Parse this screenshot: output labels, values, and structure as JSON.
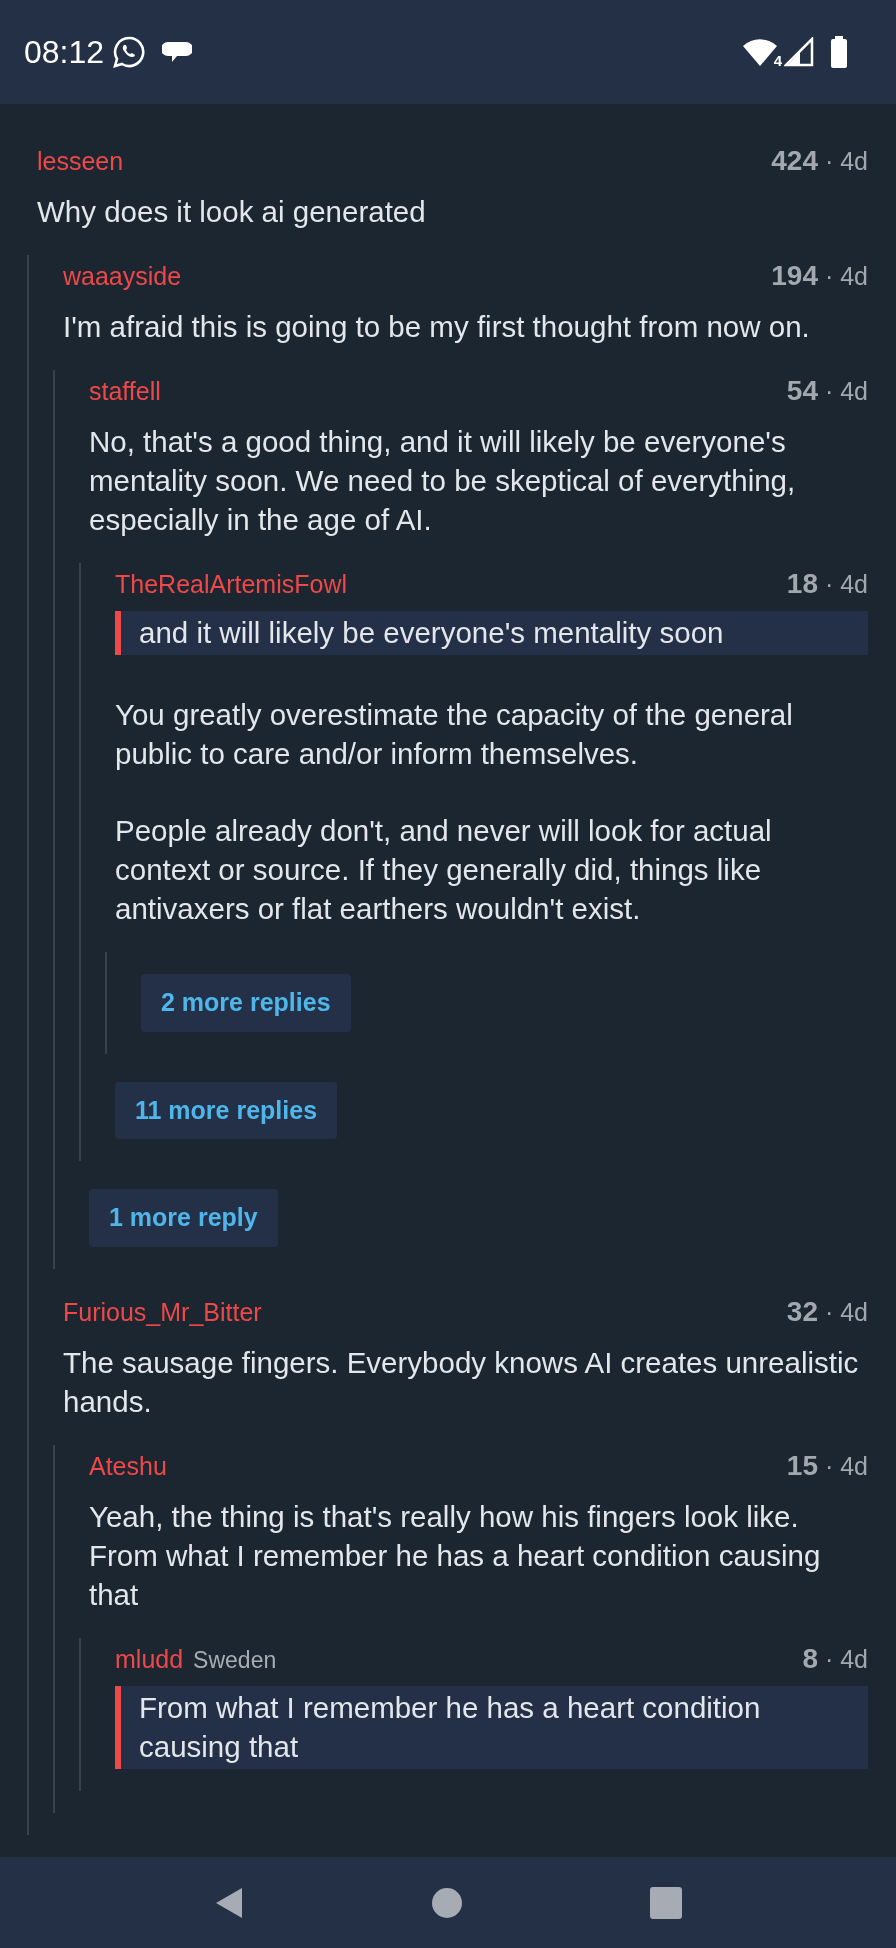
{
  "status_bar": {
    "time": "08:12",
    "wifi_badge": "4"
  },
  "comments": [
    {
      "kind": "comment",
      "author": "lesseen",
      "score": "424",
      "age": "· 4d",
      "paragraphs": [
        "Why does it look ai generated"
      ],
      "children": [
        {
          "kind": "comment",
          "author": "waaayside",
          "score": "194",
          "age": "· 4d",
          "paragraphs": [
            "I'm afraid this is going to be my first thought from now on."
          ],
          "children": [
            {
              "kind": "comment",
              "author": "staffell",
              "score": "54",
              "age": "· 4d",
              "paragraphs": [
                "No, that's a good thing, and it will likely be everyone's mentality soon. We need to be skeptical of everything, especially in the age of AI."
              ],
              "children": [
                {
                  "kind": "comment",
                  "author": "TheRealArtemisFowl",
                  "score": "18",
                  "age": "· 4d",
                  "quote": "and it will likely be everyone's mentality soon",
                  "paragraphs": [
                    "You greatly overestimate the capacity of the general public to care and/or inform themselves.",
                    "People already don't, and never will look for actual context or source. If they generally did, things like antivaxers or flat earthers wouldn't exist."
                  ],
                  "children": [
                    {
                      "kind": "more",
                      "label": "2 more replies"
                    }
                  ]
                },
                {
                  "kind": "more",
                  "label": "11 more replies"
                }
              ]
            },
            {
              "kind": "more",
              "label": "1 more reply"
            }
          ]
        },
        {
          "kind": "comment",
          "author": "Furious_Mr_Bitter",
          "score": "32",
          "age": "· 4d",
          "paragraphs": [
            "The sausage fingers. Everybody knows AI creates unrealistic hands."
          ],
          "children": [
            {
              "kind": "comment",
              "author": "Ateshu",
              "score": "15",
              "age": "· 4d",
              "paragraphs": [
                "Yeah, the thing is that's really how his fingers look like. From what I remember he has a heart condition causing that"
              ],
              "children": [
                {
                  "kind": "comment",
                  "author": "mludd",
                  "flair": "Sweden",
                  "score": "8",
                  "age": "· 4d",
                  "quote": "From what I remember he has a heart condition causing that"
                }
              ]
            }
          ]
        }
      ]
    }
  ]
}
